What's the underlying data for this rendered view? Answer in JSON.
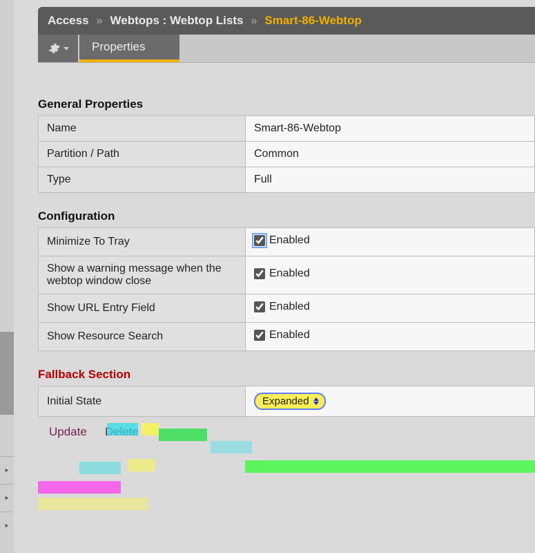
{
  "breadcrumb": {
    "root": "Access",
    "mid": "Webtops : Webtop Lists",
    "current": "Smart-86-Webtop",
    "sep": "»"
  },
  "tabs": {
    "properties": "Properties"
  },
  "sections": {
    "general": {
      "title": "General Properties",
      "rows": {
        "name": {
          "label": "Name",
          "value": "Smart-86-Webtop"
        },
        "partition": {
          "label": "Partition / Path",
          "value": "Common"
        },
        "type": {
          "label": "Type",
          "value": "Full"
        }
      }
    },
    "config": {
      "title": "Configuration",
      "rows": {
        "minimize": {
          "label": "Minimize To Tray",
          "value": "Enabled",
          "checked": true,
          "focused": true
        },
        "warn": {
          "label": "Show a warning message when the webtop window close",
          "value": "Enabled",
          "checked": true,
          "focused": false
        },
        "url": {
          "label": "Show URL Entry Field",
          "value": "Enabled",
          "checked": true,
          "focused": false
        },
        "search": {
          "label": "Show Resource Search",
          "value": "Enabled",
          "checked": true,
          "focused": false
        }
      }
    },
    "fallback": {
      "title": "Fallback Section",
      "rows": {
        "initial": {
          "label": "Initial State",
          "selected": "Expanded"
        }
      }
    }
  },
  "actions": {
    "update": "Update",
    "delete": "Delete"
  }
}
